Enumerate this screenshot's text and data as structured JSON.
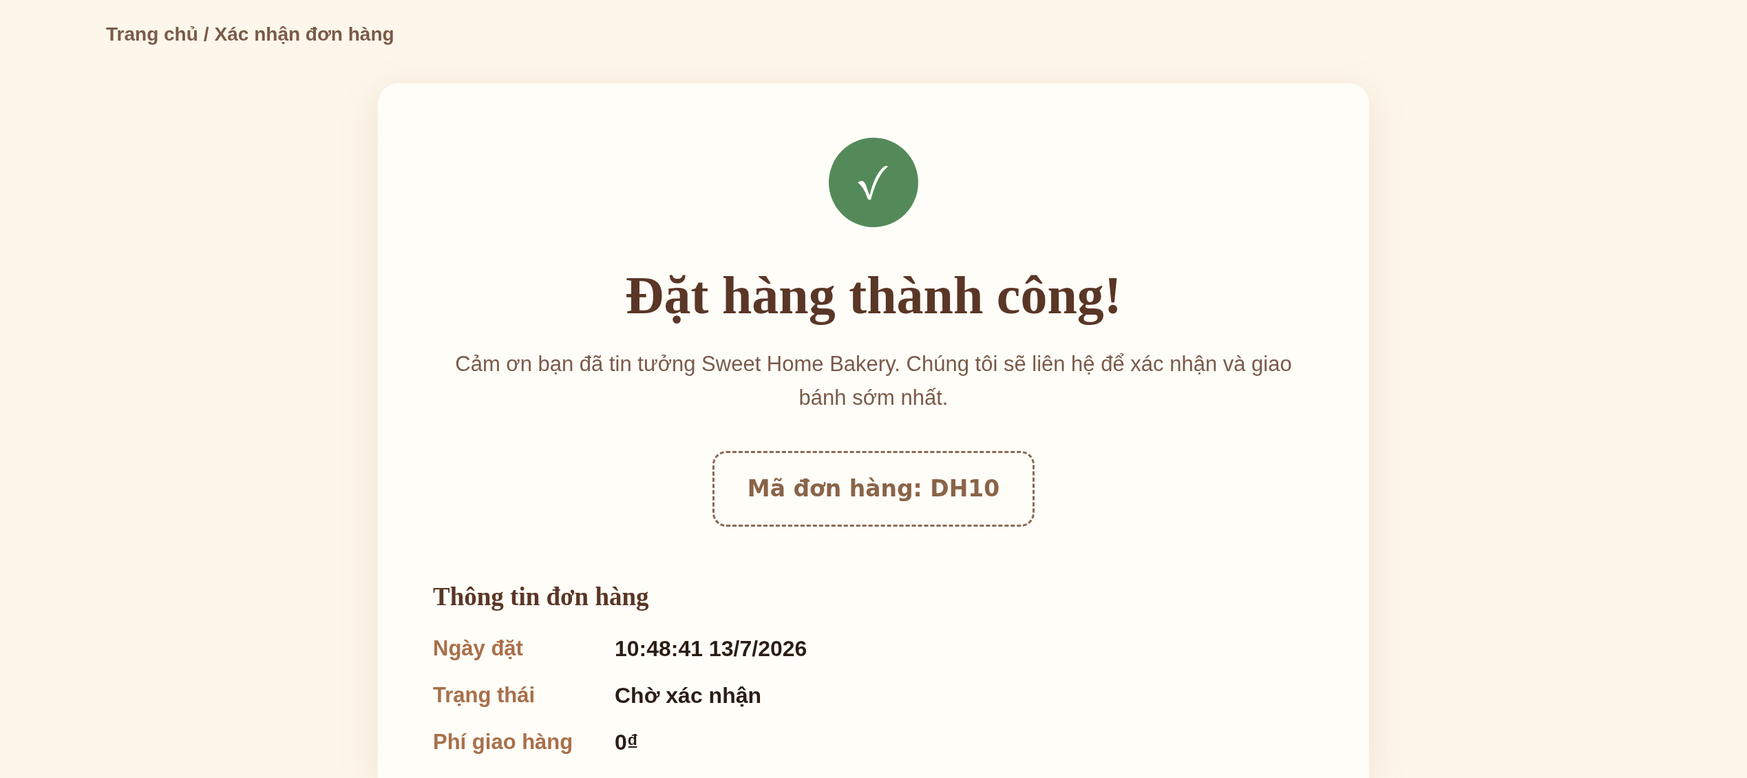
{
  "breadcrumb": {
    "items": [
      "Trang chủ",
      "Xác nhận đơn hàng"
    ],
    "separator": "/"
  },
  "confirmation": {
    "title": "Đặt hàng thành công!",
    "message": "Cảm ơn bạn đã tin tưởng Sweet Home Bakery. Chúng tôi sẽ liên hệ để xác nhận và giao bánh sớm nhất.",
    "order_code": "Mã đơn hàng: DH10"
  },
  "order_info": {
    "title": "Thông tin đơn hàng",
    "rows": [
      {
        "label": "Ngày đặt",
        "value": "10:48:41 13/7/2026"
      },
      {
        "label": "Trạng thái",
        "value": "Chờ xác nhận"
      },
      {
        "label": "Phí giao hàng",
        "value": "0₫"
      }
    ]
  }
}
